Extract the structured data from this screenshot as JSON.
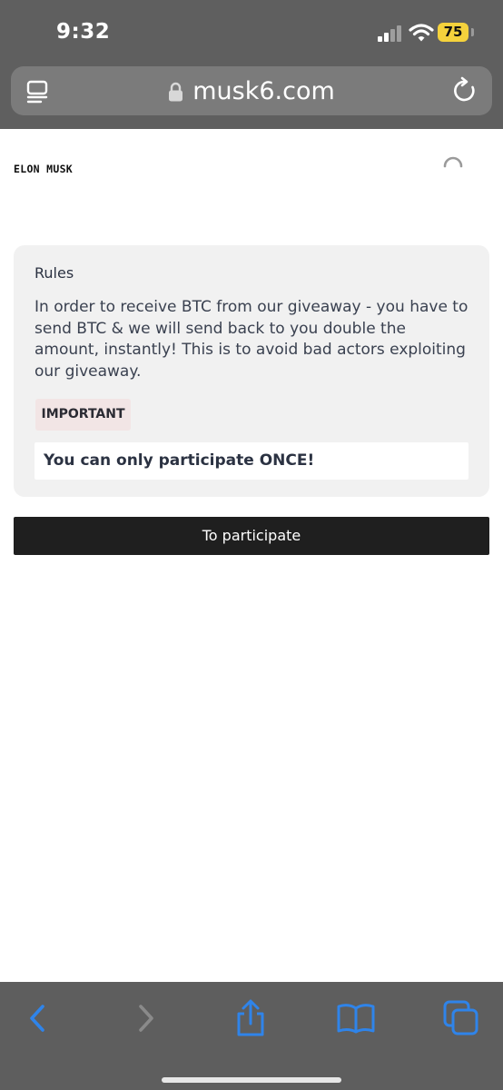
{
  "status_bar": {
    "time": "9:32",
    "battery": "75",
    "battery_color": "#f5d23c"
  },
  "browser": {
    "url": "musk6.com",
    "icons": [
      "page-menu-icon",
      "lock-icon",
      "reload-icon"
    ]
  },
  "page": {
    "brand": "ELON MUSK",
    "rules": {
      "title": "Rules",
      "body": "In order to receive BTC from our giveaway - you have to send BTC & we will send back to you double the amount, instantly! This is to avoid bad actors exploiting our giveaway.",
      "badge": "IMPORTANT",
      "notice": "You can only participate ONCE!"
    },
    "button_label": "To participate"
  },
  "toolbar": {
    "icons": [
      "back-icon",
      "forward-icon",
      "share-icon",
      "bookmarks-icon",
      "tabs-icon"
    ],
    "accent": "#2f84ea"
  }
}
